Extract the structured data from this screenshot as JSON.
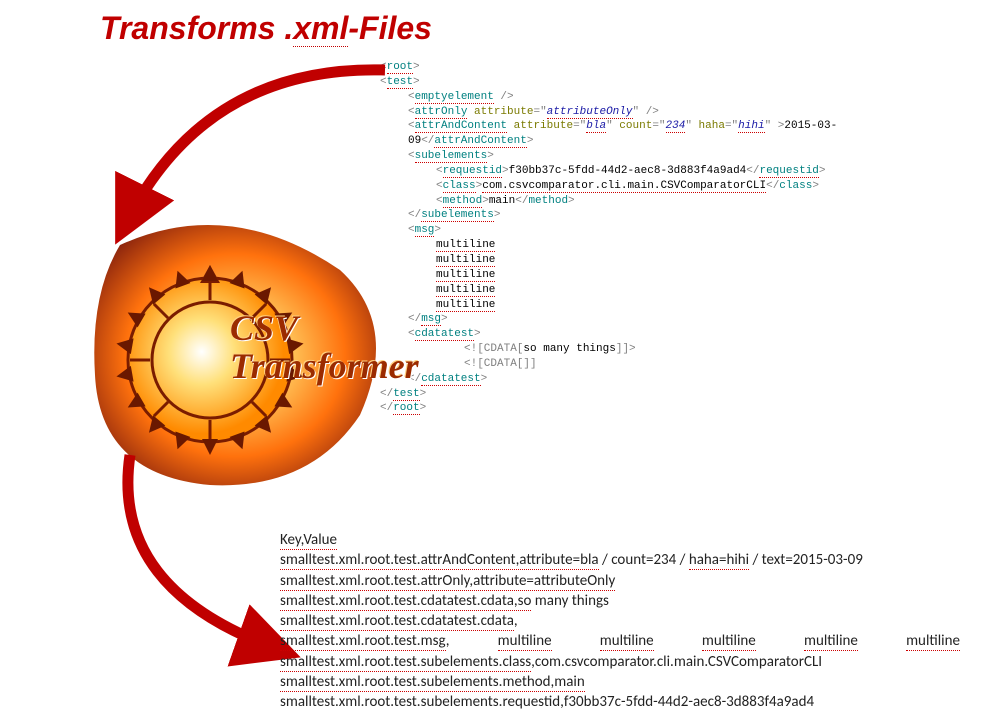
{
  "title_parts": {
    "t1": "Transforms .",
    "t2": "xml",
    "t3": "-Files"
  },
  "logo": {
    "line1": "CSV",
    "line2": "Transformer"
  },
  "xml": {
    "root_open": "root",
    "test_open": "test",
    "emptyelement": "emptyelement",
    "attrOnly_tag": "attrOnly",
    "attrOnly_attr": "attribute",
    "attrOnly_val": "attributeOnly",
    "aac_tag": "attrAndContent",
    "aac_attr1": "attribute",
    "aac_val1": "bla",
    "aac_attr2": "count",
    "aac_val2": "234",
    "aac_attr3": "haha",
    "aac_val3": "hihi",
    "aac_text": "2015-03-09",
    "subel_tag": "subelements",
    "requestid_tag": "requestid",
    "requestid_val": "f30bb37c-5fdd-44d2-aec8-3d883f4a9ad4",
    "class_tag": "class",
    "class_val": "com.csvcomparator.cli.main.CSVComparatorCLI",
    "method_tag": "method",
    "method_val": "main",
    "msg_tag": "msg",
    "msg_line": "multiline",
    "cdatatest_tag": "cdatatest",
    "cdata1": "so many things",
    "cdata_open": "<![CDATA[",
    "cdata_close": "]]>",
    "cdata_open2": "<![CDATA[]]"
  },
  "csv": {
    "header": "Key,Value",
    "r1a": "smalltest.xml.root.test.attrAndContent,attribute=bla",
    "r1b": " / count=234 / ",
    "r1c": "haha=hihi",
    "r1d": " / text=2015-03-09",
    "r2": "smalltest.xml.root.test.attrOnly,attribute=attributeOnly",
    "r3a": "smalltest.xml.root.test.cdatatest.cdata,so",
    "r3b": " many things",
    "r4": "smalltest.xml.root.test.cdatatest.cdata",
    "r4b": ",",
    "r5a": "smalltest.xml.root.test.msg",
    "r5b": ",",
    "r5w": "multiline",
    "r6": "smalltest.xml.root.test.subelements.class",
    "r6b": ",com.csvcomparator.cli.main.CSVComparatorCLI",
    "r7": "smalltest.xml.root.test.subelements.method,main",
    "r8": "smalltest.xml.root.test.subelements.requestid,f30bb37c-5fdd-44d2-aec8-3d883f4a9ad4"
  }
}
